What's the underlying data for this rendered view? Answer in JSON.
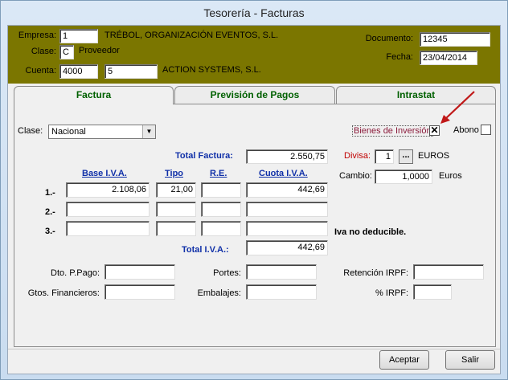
{
  "window": {
    "title": "Tesorería - Facturas"
  },
  "header": {
    "empresa_label": "Empresa:",
    "empresa_code": "1",
    "empresa_name": "TRÉBOL, ORGANIZACIÓN EVENTOS, S.L.",
    "clase_label": "Clase:",
    "clase_code": "C",
    "clase_name": "Proveedor",
    "cuenta_label": "Cuenta:",
    "cuenta_code": "4000",
    "cuenta_sub": "5",
    "cuenta_name": "ACTION SYSTEMS, S.L.",
    "documento_label": "Documento:",
    "documento_value": "12345",
    "fecha_label": "Fecha:",
    "fecha_value": "23/04/2014"
  },
  "tabs": [
    {
      "label": "Factura"
    },
    {
      "label": "Previsión de Pagos"
    },
    {
      "label": "Intrastat"
    }
  ],
  "factura": {
    "clase_label": "Clase:",
    "clase_value": "Nacional",
    "bienes_label": "Bienes de Inversión",
    "bienes_checked": true,
    "bienes_mark": "✕",
    "abono_label": "Abono",
    "abono_checked": false,
    "total_factura_label": "Total Factura:",
    "total_factura_value": "2.550,75",
    "divisa_label": "Divisa:",
    "divisa_value": "1",
    "divisa_btn": "...",
    "divisa_name": "EUROS",
    "cambio_label": "Cambio:",
    "cambio_value": "1,0000",
    "cambio_unit": "Euros",
    "col_base": "Base I.V.A.",
    "col_tipo": "Tipo",
    "col_re": "R.E.",
    "col_cuota": "Cuota I.V.A.",
    "rows": [
      {
        "label": "1.-",
        "base": "2.108,06",
        "tipo": "21,00",
        "re": "",
        "cuota": "442,69"
      },
      {
        "label": "2.-",
        "base": "",
        "tipo": "",
        "re": "",
        "cuota": ""
      },
      {
        "label": "3.-",
        "base": "",
        "tipo": "",
        "re": "",
        "cuota": ""
      }
    ],
    "iva_no_deducible": "Iva no deducible.",
    "total_iva_label": "Total I.V.A.:",
    "total_iva_value": "442,69",
    "dto_label": "Dto. P.Pago:",
    "dto_value": "",
    "gtos_label": "Gtos. Financieros:",
    "gtos_value": "",
    "portes_label": "Portes:",
    "portes_value": "",
    "embalajes_label": "Embalajes:",
    "embalajes_value": "",
    "retencion_label": "Retención IRPF:",
    "retencion_value": "",
    "irpf_label": "% IRPF:",
    "irpf_value": ""
  },
  "buttons": {
    "aceptar": "Aceptar",
    "salir": "Salir"
  },
  "colors": {
    "header_bg": "#7b7600",
    "tab_text": "#006000",
    "label_blue": "#1030a8",
    "divisa_red": "#c00000",
    "arrow_red": "#c01818"
  }
}
